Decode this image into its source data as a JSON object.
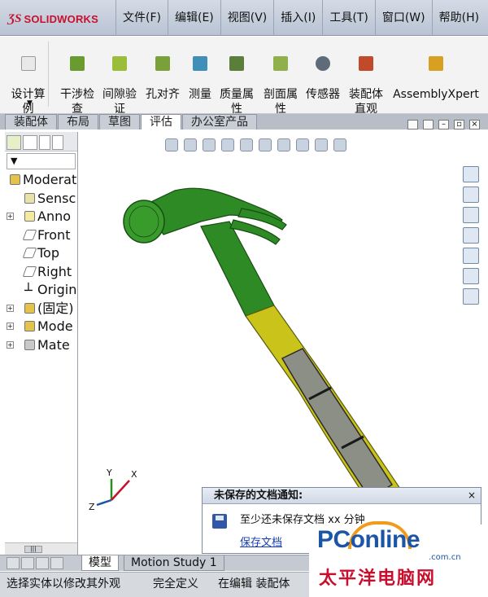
{
  "app": {
    "logo_text": "SOLIDWORKS"
  },
  "menu": {
    "items": [
      {
        "label": "文件(F)"
      },
      {
        "label": "编辑(E)"
      },
      {
        "label": "视图(V)"
      },
      {
        "label": "插入(I)"
      },
      {
        "label": "工具(T)"
      },
      {
        "label": "窗口(W)"
      },
      {
        "label": "帮助(H)"
      }
    ]
  },
  "commands": [
    {
      "label": "设计算\n例"
    },
    {
      "label": "干涉检\n查"
    },
    {
      "label": "间隙验\n证"
    },
    {
      "label": "孔对齐"
    },
    {
      "label": "测量"
    },
    {
      "label": "质量属\n性"
    },
    {
      "label": "剖面属\n性"
    },
    {
      "label": "传感器"
    },
    {
      "label": "装配体\n直观"
    },
    {
      "label": "AssemblyXpert"
    }
  ],
  "tabs": [
    {
      "label": "装配体"
    },
    {
      "label": "布局"
    },
    {
      "label": "草图"
    },
    {
      "label": "评估"
    },
    {
      "label": "办公室产品"
    }
  ],
  "feature_tree": {
    "items": [
      {
        "label": "Moderat",
        "expander": ""
      },
      {
        "label": "Sensc",
        "expander": ""
      },
      {
        "label": "Anno",
        "expander": "+"
      },
      {
        "label": "Front",
        "expander": ""
      },
      {
        "label": "Top",
        "expander": ""
      },
      {
        "label": "Right",
        "expander": ""
      },
      {
        "label": "Origin",
        "expander": ""
      },
      {
        "label": "(固定)",
        "expander": "+"
      },
      {
        "label": "Mode",
        "expander": "+"
      },
      {
        "label": "Mate",
        "expander": "+"
      }
    ]
  },
  "notification": {
    "title": "未保存的文档通知:",
    "message": "至少还未保存文档 xx 分钟",
    "link": "保存文档",
    "close": "×"
  },
  "bottom_tabs": [
    {
      "label": "模型"
    },
    {
      "label": "Motion Study 1"
    }
  ],
  "status": {
    "hint": "选择实体以修改其外观",
    "state": "完全定义",
    "editing": "在编辑 装配体"
  },
  "watermark": {
    "brand": "PConline",
    "domain": ".com.cn",
    "tagline": "太平洋电脑网"
  },
  "triad": {
    "x": "X",
    "y": "Y",
    "z": "Z"
  },
  "colors": {
    "hammer_green": "#2e8a24",
    "handle_yellow": "#c9c31a",
    "grip_gray": "#8c8f86",
    "brand_red": "#c8102e"
  }
}
